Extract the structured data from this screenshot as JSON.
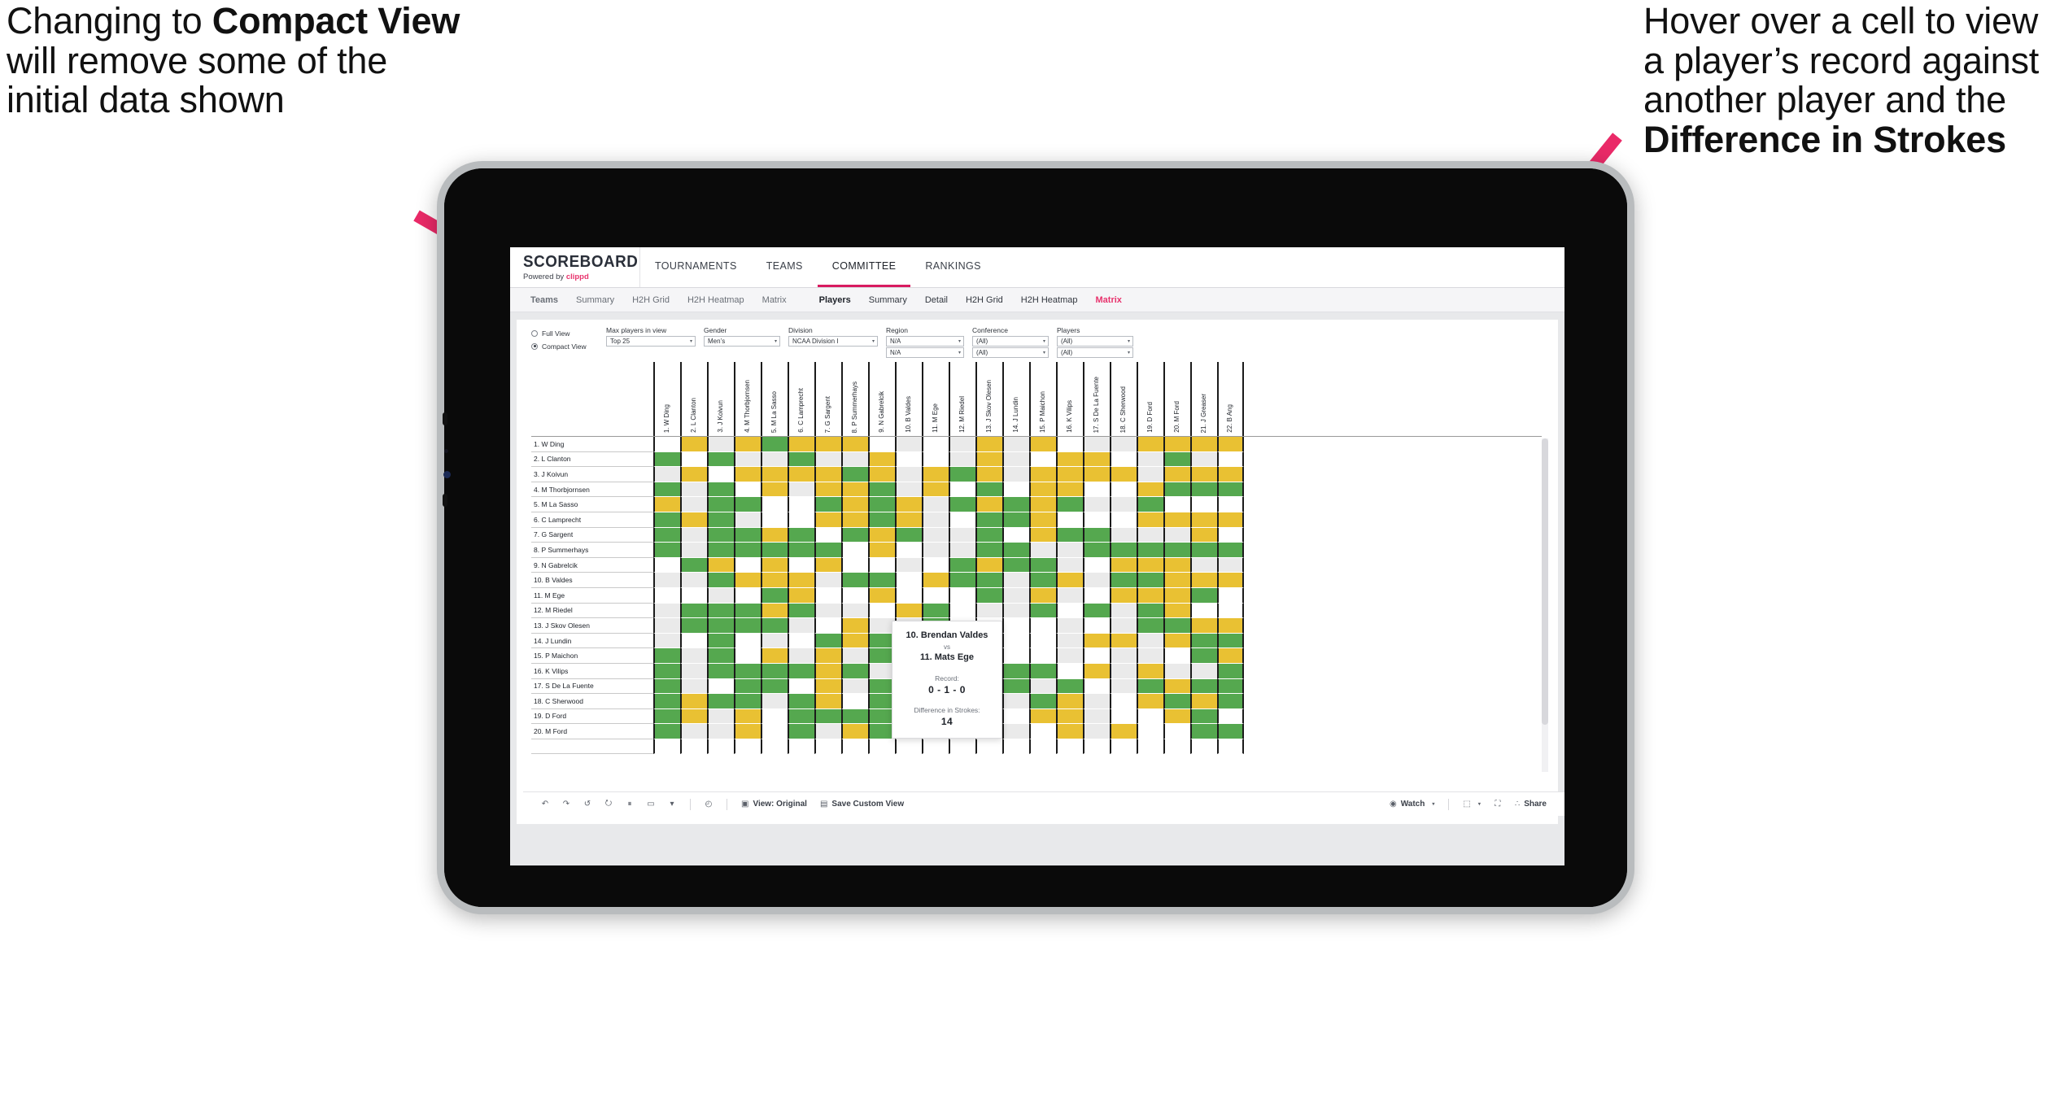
{
  "annotations": {
    "left": {
      "line1": "Changing to ",
      "bold1": "Compact View",
      "line2": " will remove some of the initial data shown"
    },
    "right": {
      "line1": "Hover over a cell to view a player’s record against another player and the ",
      "bold1": "Difference in Strokes"
    },
    "arrow_color": "#ea2a68"
  },
  "app": {
    "brand": {
      "name": "SCOREBOARD",
      "sub_prefix": "Powered by ",
      "sub_brand": "clippd"
    },
    "topnav": [
      {
        "label": "TOURNAMENTS",
        "active": false
      },
      {
        "label": "TEAMS",
        "active": false
      },
      {
        "label": "COMMITTEE",
        "active": true
      },
      {
        "label": "RANKINGS",
        "active": false
      }
    ],
    "subnav_left": [
      {
        "label": "Teams",
        "bold": true
      },
      {
        "label": "Summary"
      },
      {
        "label": "H2H Grid"
      },
      {
        "label": "H2H Heatmap"
      },
      {
        "label": "Matrix"
      }
    ],
    "subnav_right": [
      {
        "label": "Players",
        "bold": true
      },
      {
        "label": "Summary"
      },
      {
        "label": "Detail"
      },
      {
        "label": "H2H Grid"
      },
      {
        "label": "H2H Heatmap"
      },
      {
        "label": "Matrix",
        "active": true
      }
    ]
  },
  "filters": {
    "view_modes": [
      {
        "label": "Full View",
        "selected": false
      },
      {
        "label": "Compact View",
        "selected": true
      }
    ],
    "selects": [
      {
        "name": "max_players",
        "label": "Max players in view",
        "value": "Top 25",
        "value2": ""
      },
      {
        "name": "gender",
        "label": "Gender",
        "value": "Men’s",
        "value2": ""
      },
      {
        "name": "division",
        "label": "Division",
        "value": "NCAA Division I",
        "value2": ""
      },
      {
        "name": "region",
        "label": "Region",
        "value": "N/A",
        "value2": "N/A"
      },
      {
        "name": "conference",
        "label": "Conference",
        "value": "(All)",
        "value2": "(All)"
      },
      {
        "name": "players",
        "label": "Players",
        "value": "(All)",
        "value2": "(All)"
      }
    ]
  },
  "matrix": {
    "row_labels": [
      "1. W Ding",
      "2. L Clanton",
      "3. J Koivun",
      "4. M Thorbjornsen",
      "5. M La Sasso",
      "6. C Lamprecht",
      "7. G Sargent",
      "8. P Summerhays",
      "9. N Gabrelcik",
      "10. B Valdes",
      "11. M Ege",
      "12. M Riedel",
      "13. J Skov Olesen",
      "14. J Lundin",
      "15. P Maichon",
      "16. K Vilips",
      "17. S De La Fuente",
      "18. C Sherwood",
      "19. D Ford",
      "20. M Ford"
    ],
    "col_labels": [
      "1. W Ding",
      "2. L Clanton",
      "3. J Koivun",
      "4. M Thorbjornsen",
      "5. M La Sasso",
      "6. C Lamprecht",
      "7. G Sargent",
      "8. P Summerhays",
      "9. N Gabrelcik",
      "10. B Valdes",
      "11. M Ege",
      "12. M Riedel",
      "13. J Skov Olesen",
      "14. J Lundin",
      "15. P Maichon",
      "16. K Vilips",
      "17. S De La Fuente",
      "18. C Sherwood",
      "19. D Ford",
      "20. M Ford",
      "21. J Greaser",
      "22. B Ang"
    ],
    "legend": {
      "green": "#55a84f",
      "yellow": "#e9c133",
      "grey": "#eaeaea",
      "white": "#ffffff"
    },
    "cells": [
      [
        "b",
        "y",
        "g",
        "y",
        "n",
        "y",
        "y",
        "y",
        "w",
        "g",
        "w",
        "g",
        "y",
        "g",
        "y",
        "w",
        "g",
        "g",
        "y",
        "y",
        "y",
        "y"
      ],
      [
        "n",
        "b",
        "n",
        "g",
        "g",
        "n",
        "g",
        "g",
        "y",
        "w",
        "w",
        "g",
        "y",
        "g",
        "w",
        "y",
        "y",
        "w",
        "g",
        "n",
        "g",
        "w"
      ],
      [
        "g",
        "y",
        "b",
        "y",
        "y",
        "y",
        "y",
        "n",
        "y",
        "g",
        "y",
        "n",
        "y",
        "g",
        "y",
        "y",
        "y",
        "y",
        "g",
        "y",
        "y",
        "y"
      ],
      [
        "n",
        "g",
        "n",
        "b",
        "y",
        "g",
        "y",
        "y",
        "n",
        "g",
        "y",
        "w",
        "n",
        "w",
        "y",
        "y",
        "w",
        "w",
        "y",
        "n",
        "n",
        "n"
      ],
      [
        "y",
        "g",
        "n",
        "n",
        "b",
        "w",
        "n",
        "y",
        "n",
        "y",
        "g",
        "n",
        "y",
        "n",
        "y",
        "n",
        "g",
        "g",
        "n",
        "w",
        "w",
        "w"
      ],
      [
        "n",
        "y",
        "n",
        "g",
        "w",
        "b",
        "y",
        "y",
        "n",
        "y",
        "g",
        "w",
        "n",
        "n",
        "y",
        "w",
        "w",
        "w",
        "y",
        "y",
        "y",
        "y"
      ],
      [
        "n",
        "g",
        "n",
        "n",
        "y",
        "n",
        "b",
        "n",
        "y",
        "n",
        "g",
        "g",
        "n",
        "w",
        "y",
        "n",
        "n",
        "g",
        "g",
        "g",
        "y",
        "w"
      ],
      [
        "n",
        "g",
        "n",
        "n",
        "n",
        "n",
        "n",
        "b",
        "y",
        "w",
        "g",
        "g",
        "n",
        "n",
        "g",
        "g",
        "n",
        "n",
        "n",
        "n",
        "n",
        "n"
      ],
      [
        "w",
        "n",
        "y",
        "w",
        "y",
        "w",
        "y",
        "w",
        "b",
        "g",
        "w",
        "n",
        "y",
        "n",
        "n",
        "g",
        "w",
        "y",
        "y",
        "y",
        "g",
        "g"
      ],
      [
        "g",
        "g",
        "n",
        "y",
        "y",
        "y",
        "g",
        "n",
        "n",
        "b",
        "y",
        "n",
        "n",
        "g",
        "n",
        "y",
        "g",
        "n",
        "n",
        "y",
        "y",
        "y"
      ],
      [
        "w",
        "w",
        "g",
        "w",
        "n",
        "y",
        "w",
        "w",
        "y",
        "w",
        "b",
        "w",
        "n",
        "g",
        "y",
        "g",
        "w",
        "y",
        "y",
        "y",
        "n",
        "w"
      ],
      [
        "g",
        "n",
        "n",
        "n",
        "y",
        "n",
        "g",
        "g",
        "w",
        "y",
        "n",
        "b",
        "g",
        "g",
        "n",
        "w",
        "n",
        "g",
        "n",
        "y",
        "w",
        "w"
      ],
      [
        "g",
        "n",
        "n",
        "n",
        "n",
        "g",
        "w",
        "y",
        "g",
        "g",
        "n",
        "w",
        "b",
        "w",
        "w",
        "g",
        "w",
        "g",
        "n",
        "n",
        "y",
        "y"
      ],
      [
        "g",
        "w",
        "n",
        "w",
        "g",
        "w",
        "n",
        "y",
        "n",
        "g",
        "n",
        "w",
        "w",
        "b",
        "w",
        "g",
        "y",
        "y",
        "g",
        "y",
        "n",
        "n"
      ],
      [
        "n",
        "g",
        "n",
        "w",
        "y",
        "g",
        "y",
        "g",
        "n",
        "y",
        "g",
        "g",
        "y",
        "w",
        "b",
        "g",
        "w",
        "g",
        "g",
        "w",
        "n",
        "y"
      ],
      [
        "n",
        "g",
        "n",
        "n",
        "n",
        "n",
        "y",
        "n",
        "g",
        "n",
        "w",
        "y",
        "w",
        "n",
        "n",
        "b",
        "y",
        "g",
        "y",
        "g",
        "g",
        "n"
      ],
      [
        "n",
        "g",
        "w",
        "n",
        "n",
        "w",
        "y",
        "g",
        "n",
        "y",
        "g",
        "g",
        "y",
        "n",
        "g",
        "n",
        "b",
        "g",
        "n",
        "y",
        "n",
        "n"
      ],
      [
        "n",
        "y",
        "n",
        "n",
        "g",
        "n",
        "y",
        "w",
        "n",
        "y",
        "g",
        "y",
        "w",
        "g",
        "n",
        "y",
        "g",
        "b",
        "y",
        "n",
        "y",
        "n"
      ],
      [
        "n",
        "y",
        "g",
        "y",
        "w",
        "n",
        "n",
        "n",
        "n",
        "g",
        "n",
        "n",
        "y",
        "w",
        "y",
        "y",
        "g",
        "w",
        "b",
        "y",
        "n",
        "w"
      ],
      [
        "n",
        "g",
        "g",
        "y",
        "w",
        "n",
        "g",
        "y",
        "n",
        "n",
        "n",
        "w",
        "n",
        "g",
        "w",
        "y",
        "g",
        "y",
        "w",
        "b",
        "n",
        "n"
      ]
    ]
  },
  "tooltip": {
    "player_a": "10. Brendan Valdes",
    "vs": "vs",
    "player_b": "11. Mats Ege",
    "record_label": "Record:",
    "record_value": "0 - 1 - 0",
    "strokes_label": "Difference in Strokes:",
    "strokes_value": "14"
  },
  "toolbar": {
    "icons": [
      {
        "name": "undo-icon",
        "glyph": "↶"
      },
      {
        "name": "redo-icon",
        "glyph": "↷"
      },
      {
        "name": "revert-icon",
        "glyph": "↺"
      },
      {
        "name": "refresh-data-icon",
        "glyph": "⭮"
      },
      {
        "name": "pause-updates-icon",
        "glyph": "⏸"
      },
      {
        "name": "highlight-icon",
        "glyph": "▭"
      },
      {
        "name": "highlight-caret-icon",
        "glyph": "▾"
      }
    ],
    "clock_icon": "◴",
    "view_original": {
      "label": "View: Original",
      "icon": "▣"
    },
    "save_custom_view": {
      "label": "Save Custom View",
      "icon": "▤"
    },
    "watch": {
      "label": "Watch",
      "icon": "◉",
      "caret": "▾"
    },
    "device_preview": {
      "icon": "⬚",
      "caret": "▾"
    },
    "fullscreen": {
      "icon": "⛶"
    },
    "share": {
      "label": "Share",
      "icon": "∴"
    }
  }
}
